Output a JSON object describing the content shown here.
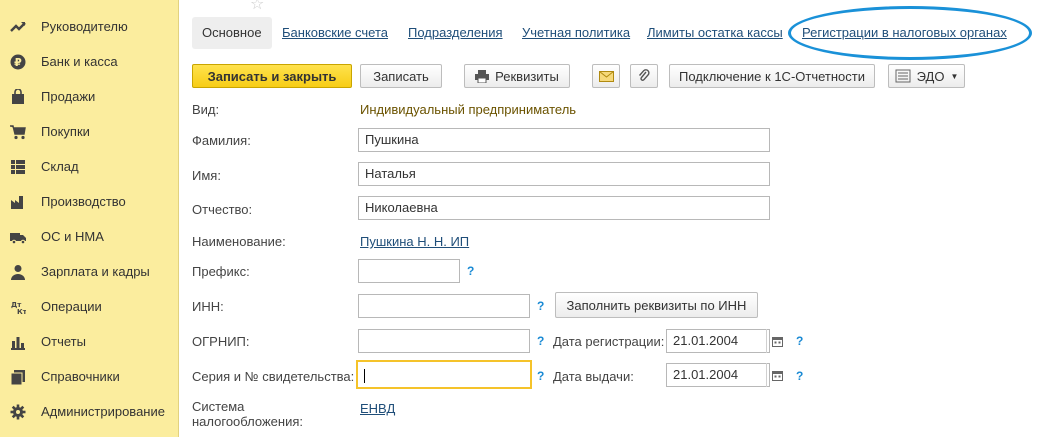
{
  "sidebar": {
    "items": [
      {
        "label": "Руководителю",
        "icon": "trend-icon"
      },
      {
        "label": "Банк и касса",
        "icon": "ruble-icon"
      },
      {
        "label": "Продажи",
        "icon": "bag-icon"
      },
      {
        "label": "Покупки",
        "icon": "cart-icon"
      },
      {
        "label": "Склад",
        "icon": "warehouse-icon"
      },
      {
        "label": "Производство",
        "icon": "factory-icon"
      },
      {
        "label": "ОС и НМА",
        "icon": "truck-icon"
      },
      {
        "label": "Зарплата и кадры",
        "icon": "person-icon"
      },
      {
        "label": "Операции",
        "icon": "debit-credit-icon"
      },
      {
        "label": "Отчеты",
        "icon": "bar-chart-icon"
      },
      {
        "label": "Справочники",
        "icon": "books-icon"
      },
      {
        "label": "Администрирование",
        "icon": "gear-icon"
      }
    ]
  },
  "tabs": [
    {
      "label": "Основное",
      "active": true
    },
    {
      "label": "Банковские счета"
    },
    {
      "label": "Подразделения"
    },
    {
      "label": "Учетная политика"
    },
    {
      "label": "Лимиты остатка кассы"
    },
    {
      "label": "Регистрации в налоговых органах"
    }
  ],
  "toolbar": {
    "save_close": "Записать и закрыть",
    "save": "Записать",
    "details": "Реквизиты",
    "connect": "Подключение к 1С-Отчетности",
    "edo": "ЭДО"
  },
  "form": {
    "kind_label": "Вид:",
    "kind_value": "Индивидуальный предприниматель",
    "surname_label": "Фамилия:",
    "surname_value": "Пушкина",
    "name_label": "Имя:",
    "name_value": "Наталья",
    "patronymic_label": "Отчество:",
    "patronymic_value": "Николаевна",
    "title_label": "Наименование:",
    "title_value": "Пушкина Н. Н. ИП",
    "prefix_label": "Префикс:",
    "prefix_value": "",
    "inn_label": "ИНН:",
    "inn_value": "",
    "fill_by_inn": "Заполнить реквизиты по ИНН",
    "ogrnip_label": "ОГРНИП:",
    "ogrnip_value": "",
    "reg_date_label": "Дата регистрации:",
    "reg_date_value": "21.01.2004",
    "cert_label": "Серия и № свидетельства:",
    "cert_value": "",
    "issue_date_label": "Дата выдачи:",
    "issue_date_value": "21.01.2004",
    "tax_system_label_1": "Система",
    "tax_system_label_2": "налогообложения:",
    "tax_system_value": "ЕНВД",
    "help": "?"
  },
  "colors": {
    "sidebar_bg": "#fbed9e",
    "primary_button": "#f7cd16",
    "link": "#1f4e79",
    "highlight_oval": "#1a91d8",
    "focus_border": "#f5c32a"
  }
}
